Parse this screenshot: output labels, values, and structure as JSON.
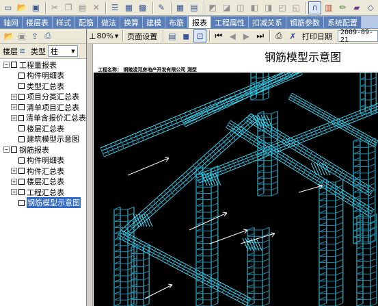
{
  "menu_tabs": [
    "轴网",
    "楼层表",
    "样式",
    "配筋",
    "做法",
    "换算",
    "建模",
    "布筋",
    "报表",
    "工程属性",
    "扣减关系",
    "钢筋参数",
    "系统配置"
  ],
  "active_tab": "报表",
  "filter": {
    "floor_label": "楼层",
    "type_label": "类型",
    "type_value": "柱"
  },
  "tree": {
    "group1": {
      "label": "工程量报表"
    },
    "g1_items": [
      "构件明细表",
      "类型汇总表",
      "项目分类汇总表",
      "清单项目汇总表",
      "清单含报价汇总表",
      "楼层汇总表",
      "建筑模型示意图"
    ],
    "group2": {
      "label": "钢筋报表"
    },
    "g2_items": [
      "构件明细表",
      "构件汇总表",
      "楼层汇总表",
      "工程汇总表",
      "钢筋模型示意图"
    ]
  },
  "report_toolbar": {
    "zoom": "80%",
    "page_setup": "页面设置",
    "print_date_label": "打印日期",
    "print_date_value": "2009-09-21"
  },
  "report": {
    "title": "钢筋模型示意图",
    "project_line": "工程名称：  铜陵凌河房地产开发有限公司  测型"
  },
  "colors": {
    "rebar": "#3fd8f0",
    "rebar_dark": "#1a8fb0",
    "canvas_bg": "#000000",
    "tab_bg": "#5a7fb8",
    "selection": "#316ac5"
  }
}
